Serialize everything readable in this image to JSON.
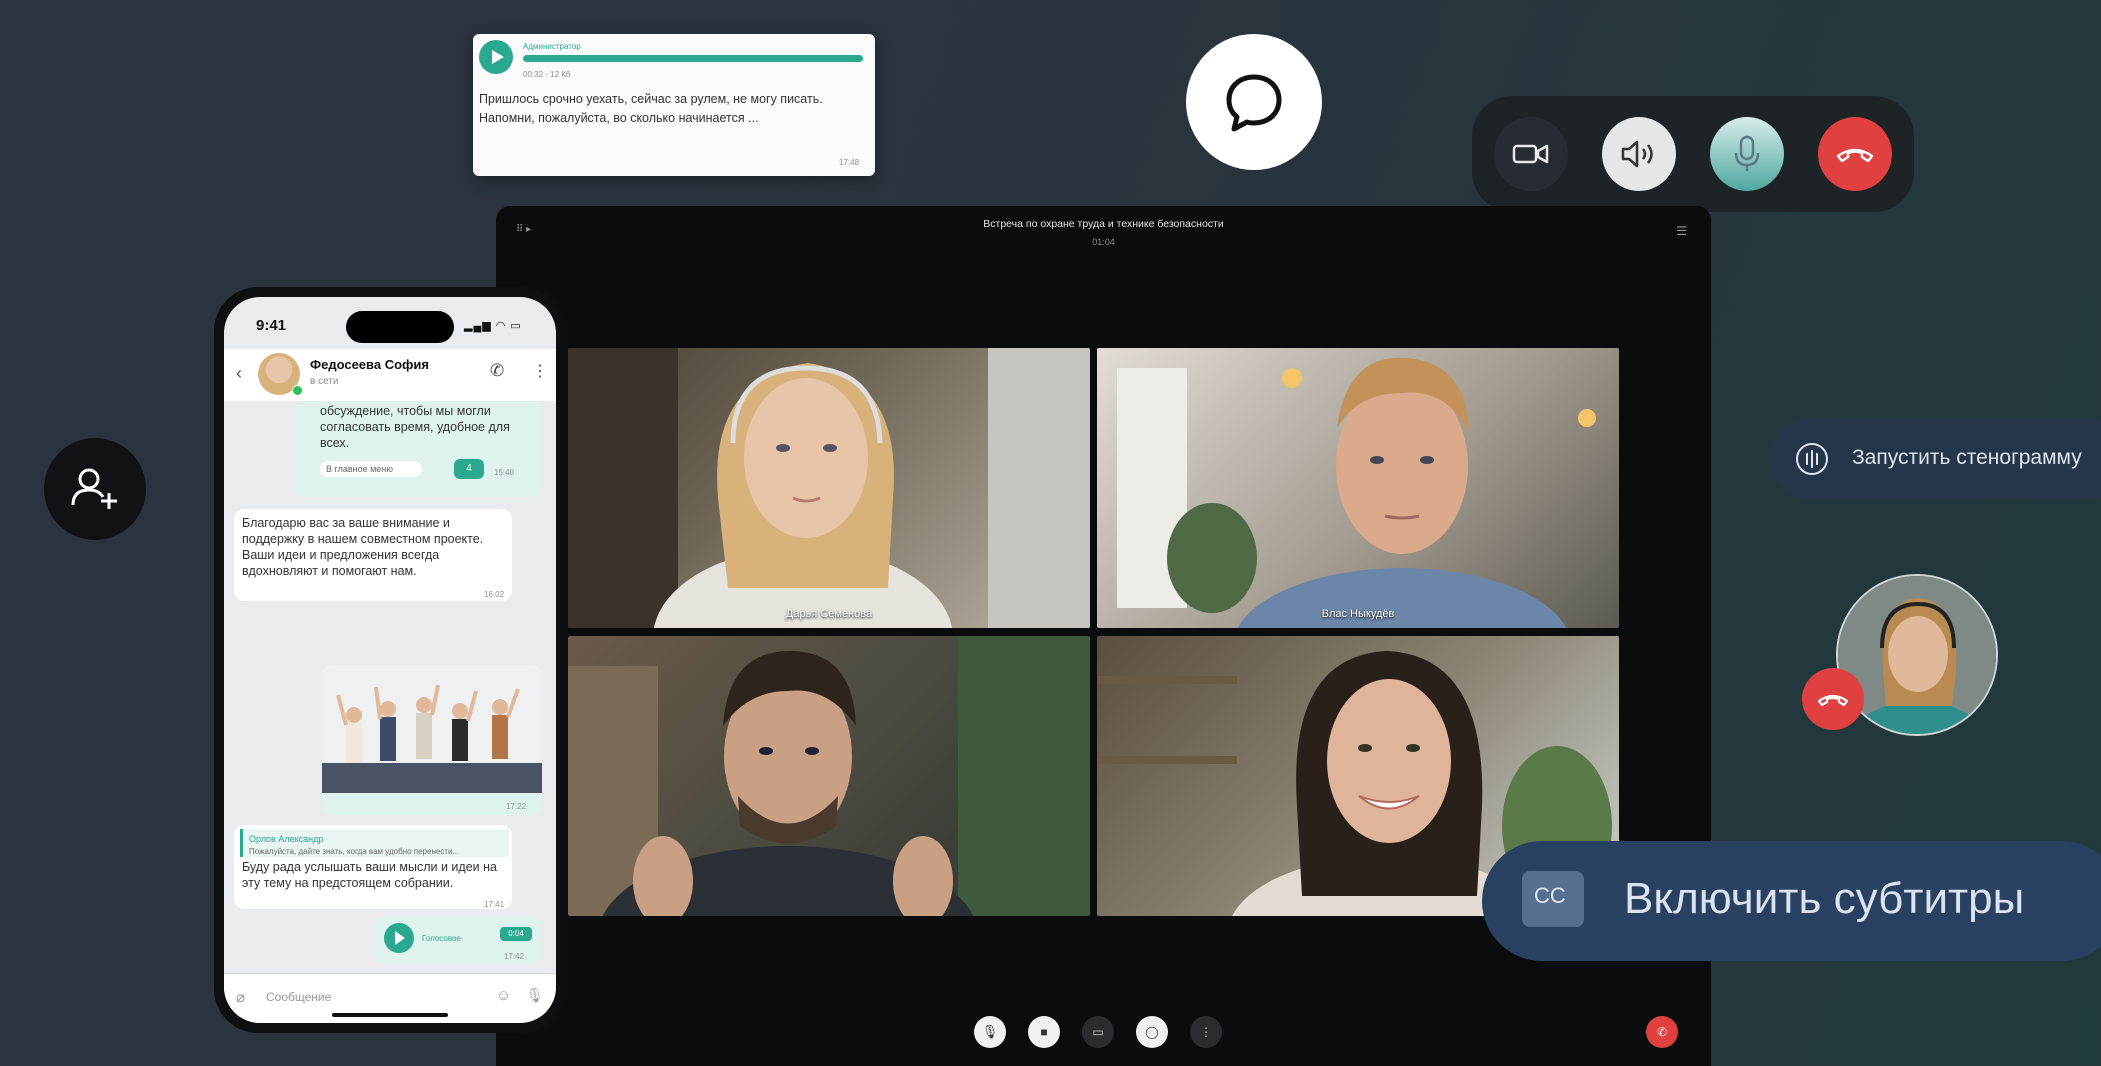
{
  "voice_message": {
    "sender": "Администратор",
    "duration": "00:32 · 12 Кб",
    "text": "Пришлось срочно уехать, сейчас за рулем, не могу писать. Напомни, пожалуйста, во сколько начинается ...",
    "time": "17:48"
  },
  "conference": {
    "title": "Встреча по охране труда и технике безопасности",
    "timer": "01:04",
    "participants": [
      {
        "name": "Дарья Семенова"
      },
      {
        "name": "Влас Ныкудёв"
      },
      {
        "name": ""
      },
      {
        "name": ""
      }
    ]
  },
  "phone": {
    "status_time": "9:41",
    "contact_name": "Федосеева София",
    "contact_status": "в сети",
    "messages": {
      "m1": "обсуждение, чтобы мы могли согласовать время, удобное для всех.",
      "m1_meta": "В главное меню",
      "m1_badge": "4",
      "m1_time": "15:40",
      "m2": "Благодарю вас за ваше внимание и поддержку в нашем совместном проекте. Ваши идеи и предложения всегда вдохновляют и помогают нам.",
      "m2_time": "16:02",
      "photo_time": "17:22",
      "reply_author": "Орлов Александр",
      "reply_quote": "Пожалуйста, дайте знать, когда вам удобно перенести...",
      "m3": "Буду рада услышать ваши мысли и идеи на эту тему на предстоящем собрании.",
      "m3_time": "17:41",
      "voice_label": "Голосовое",
      "voice_badge": "0:04",
      "voice_time": "17:42"
    },
    "input_placeholder": "Сообщение"
  },
  "actions": {
    "transcript": "Запустить стенограмму",
    "subtitles": "Включить субтитры",
    "cc_icon": "CC"
  },
  "colors": {
    "accent": "#2aa890",
    "hangup": "#e0403f",
    "subtitles_bg": "#294161"
  }
}
